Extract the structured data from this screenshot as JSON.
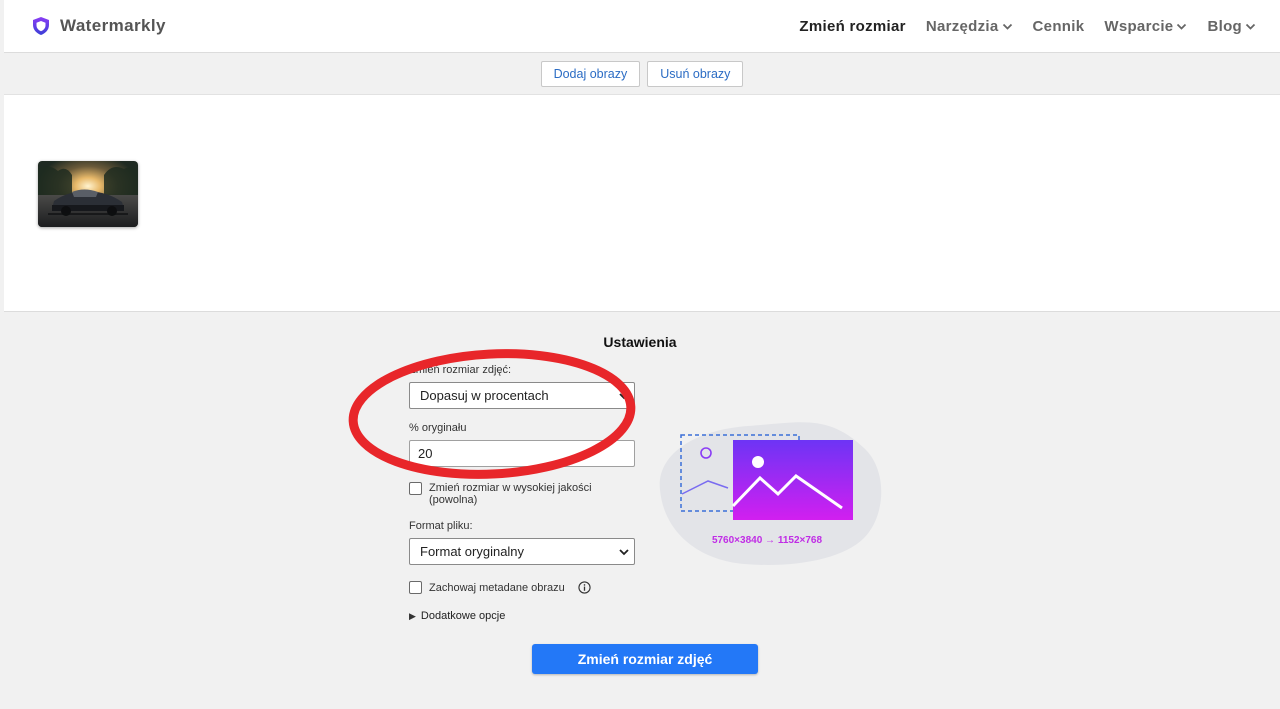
{
  "header": {
    "brand": "Watermarkly",
    "nav": [
      {
        "label": "Zmień rozmiar",
        "dropdown": false,
        "active": true
      },
      {
        "label": "Narzędzia",
        "dropdown": true
      },
      {
        "label": "Cennik",
        "dropdown": false
      },
      {
        "label": "Wsparcie",
        "dropdown": true
      },
      {
        "label": "Blog",
        "dropdown": true
      }
    ]
  },
  "toolbar": {
    "add_label": "Dodaj obrazy",
    "remove_label": "Usuń obrazy"
  },
  "settings": {
    "title": "Ustawienia",
    "resize_label": "Zmień rozmiar zdjęć:",
    "resize_mode": "Dopasuj w procentach",
    "percent_label": "% oryginału",
    "percent_value": "20",
    "quality_label": "Zmień rozmiar w wysokiej jakości (powolna)",
    "format_label": "Format pliku:",
    "format_value": "Format oryginalny",
    "metadata_label": "Zachowaj metadane obrazu",
    "more_options": "Dodatkowe opcje",
    "submit_label": "Zmień rozmiar zdjęć"
  },
  "preview": {
    "dimensions": "5760×3840 → 1152×768"
  },
  "colors": {
    "accent": "#2378f7",
    "link": "#2b6cc4",
    "annotation": "#e8262a",
    "gradient_top": "#7b2cf5",
    "gradient_bottom": "#d11fe8"
  },
  "icons": [
    "shield-logo-icon",
    "chevron-down-icon",
    "info-icon",
    "triangle-right-icon"
  ]
}
